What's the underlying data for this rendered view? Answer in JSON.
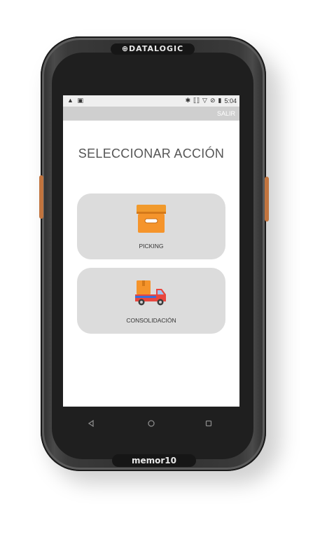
{
  "device": {
    "brand_top": "⊕DATALOGIC",
    "brand_bottom": "memor10"
  },
  "status_bar": {
    "left_icons": [
      "alert-icon",
      "image-icon"
    ],
    "right_icons": [
      "bluetooth-icon",
      "vibrate-icon",
      "wifi-icon",
      "no-sim-icon",
      "battery-icon"
    ],
    "time": "5:04"
  },
  "app_bar": {
    "exit_label": "SALIR"
  },
  "main": {
    "title": "SELECCIONAR ACCIÓN",
    "actions": [
      {
        "label": "PICKING",
        "icon": "box-icon"
      },
      {
        "label": "CONSOLIDACIÓN",
        "icon": "delivery-truck-icon"
      }
    ]
  },
  "nav_bar": {
    "buttons": [
      "back-icon",
      "home-icon",
      "recents-icon"
    ]
  },
  "colors": {
    "card_bg": "#dcdcdc",
    "app_bar_bg": "#cfcfcf",
    "box_orange": "#f5942b",
    "truck_red": "#e8473f",
    "truck_blue": "#3b6fd8"
  }
}
